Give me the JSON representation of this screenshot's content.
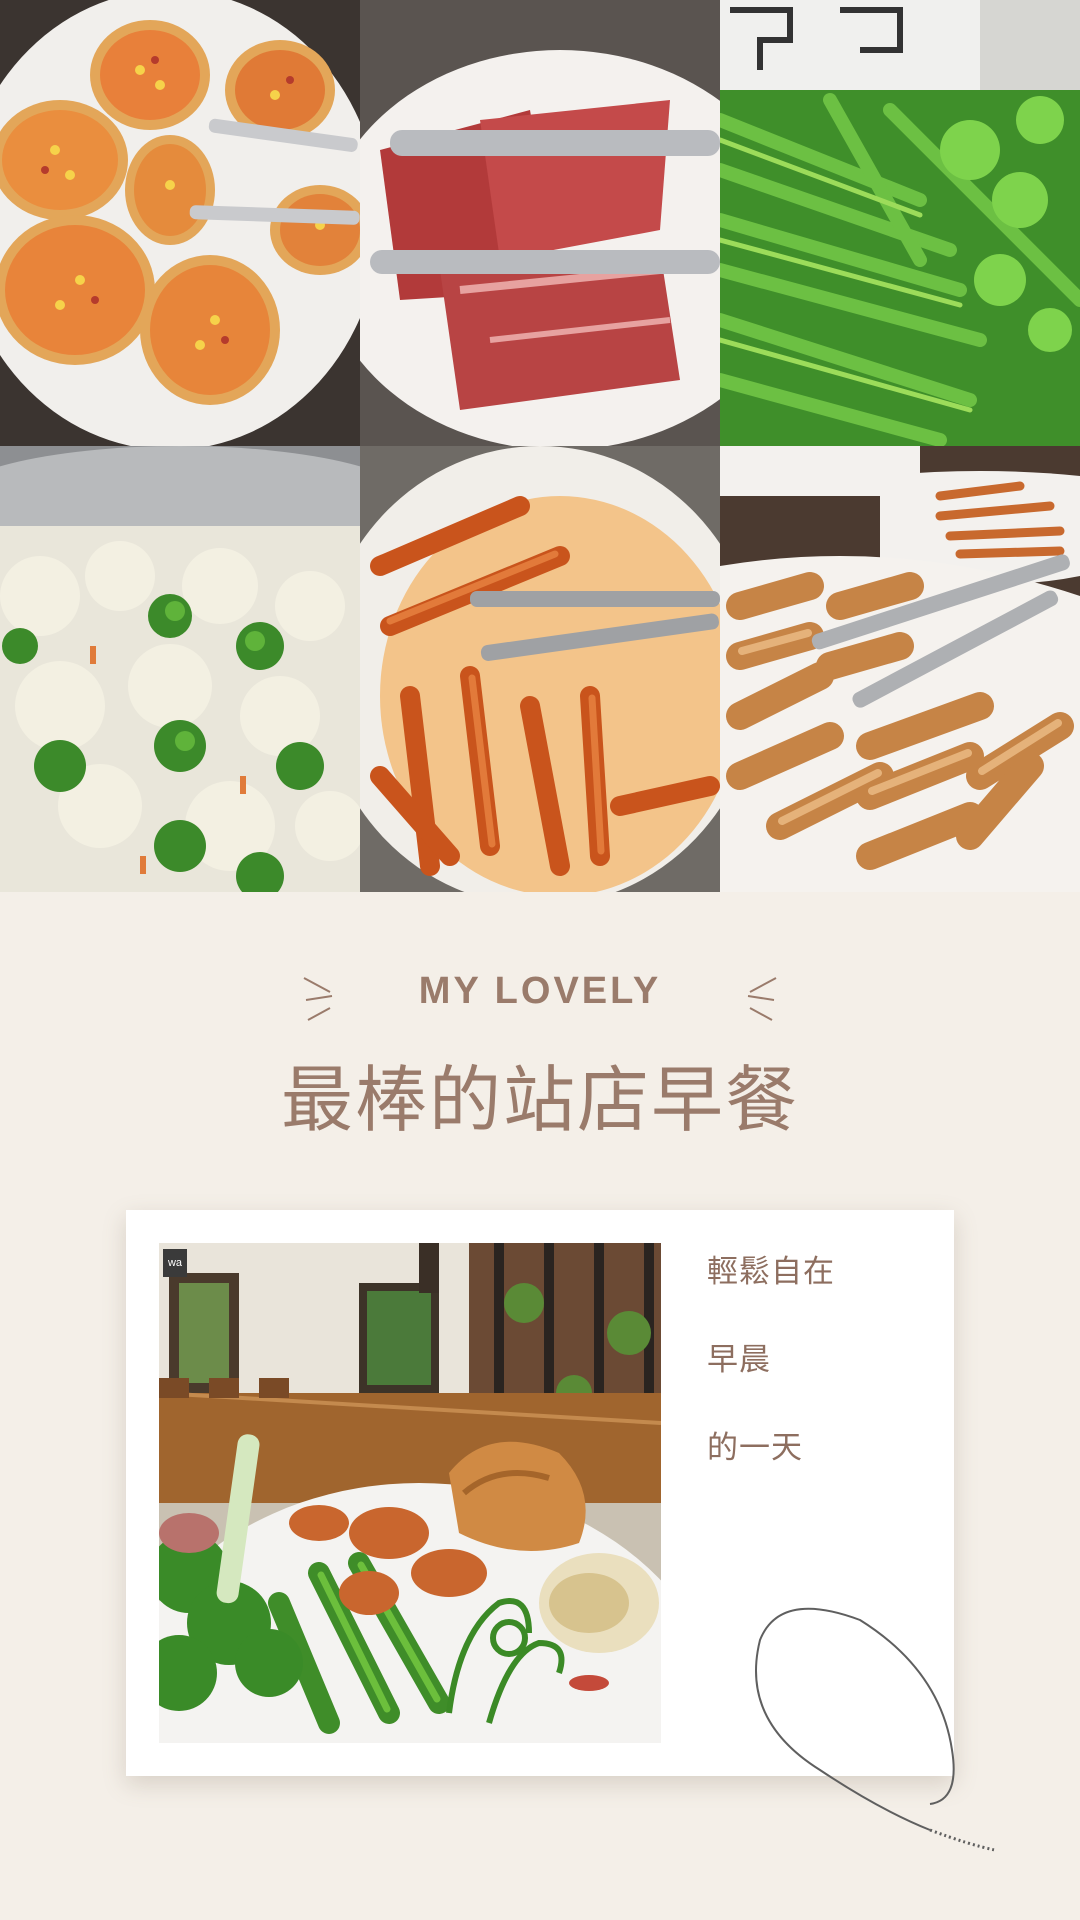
{
  "heading": {
    "subtitle": "MY LOVELY",
    "title": "最棒的站店早餐"
  },
  "card": {
    "taglines": [
      "輕鬆自在",
      "早晨",
      "的一天"
    ],
    "photo_logo_text": "wa"
  },
  "photos": [
    {
      "name": "pizza-photo",
      "subject": "mini pizzas with corn"
    },
    {
      "name": "bacon-photo",
      "subject": "bacon slices with tongs"
    },
    {
      "name": "fern-photo",
      "subject": "green fiddlehead ferns"
    },
    {
      "name": "cauliflower-photo",
      "subject": "cauliflower and broccoli"
    },
    {
      "name": "sausage-photo",
      "subject": "fried sausage sticks"
    },
    {
      "name": "spring-roll-photo",
      "subject": "spring rolls"
    }
  ],
  "colors": {
    "background": "#f4efe8",
    "accent_text": "#9a7b6b",
    "tagline_text": "#8d6e5f",
    "card": "#ffffff"
  }
}
